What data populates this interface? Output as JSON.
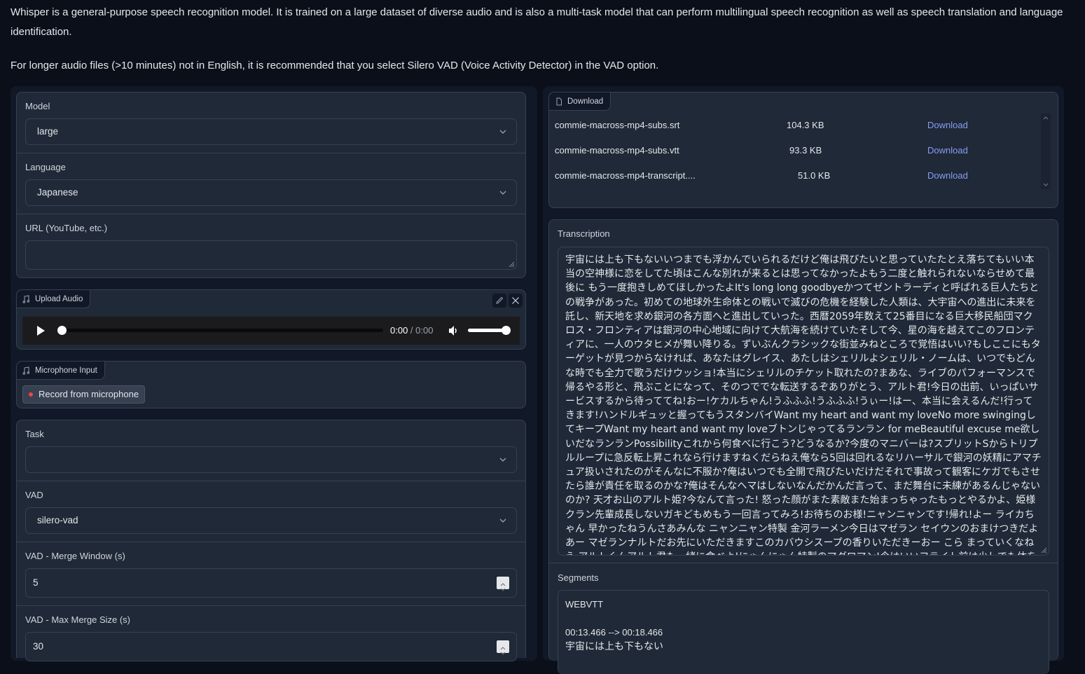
{
  "intro": {
    "paragraph1": "Whisper is a general-purpose speech recognition model. It is trained on a large dataset of diverse audio and is also a multi-task model that can perform multilingual speech recognition as well as speech translation and language identification.",
    "paragraph2": "For longer audio files (>10 minutes) not in English, it is recommended that you select Silero VAD (Voice Activity Detector) in the VAD option."
  },
  "left": {
    "model": {
      "label": "Model",
      "value": "large"
    },
    "language": {
      "label": "Language",
      "value": "Japanese"
    },
    "url": {
      "label": "URL (YouTube, etc.)",
      "value": ""
    },
    "upload_audio": {
      "label": "Upload Audio",
      "current_time": "0:00",
      "separator": " / ",
      "duration": "0:00",
      "progress_fraction": 0,
      "volume_fraction": 1.0
    },
    "microphone": {
      "label": "Microphone Input",
      "record_button": "Record from microphone"
    },
    "task": {
      "label": "Task",
      "value": ""
    },
    "vad": {
      "label": "VAD",
      "value": "silero-vad"
    },
    "vad_merge_window": {
      "label": "VAD - Merge Window (s)",
      "value": "5"
    },
    "vad_max_merge_size": {
      "label": "VAD - Max Merge Size (s)",
      "value": "30"
    }
  },
  "right": {
    "download": {
      "label": "Download",
      "files": [
        {
          "name": "commie-macross-mp4-subs.srt",
          "size": "104.3 KB",
          "link": "Download"
        },
        {
          "name": "commie-macross-mp4-subs.vtt",
          "size": "93.3 KB",
          "link": "Download"
        },
        {
          "name": "commie-macross-mp4-transcript....",
          "size": "51.0 KB",
          "link": "Download"
        }
      ]
    },
    "transcription": {
      "label": "Transcription",
      "text": "宇宙には上も下もないいつまでも浮かんでいられるだけど俺は飛びたいと思っていたたとえ落ちてもいい本当の空神様に恋をしてた頃はこんな別れが来るとは思ってなかったよもう二度と触れられないならせめて最後に もう一度抱きしめてほしかったよIt's long long goodbyeかつてゼントラーディと呼ばれる巨人たちとの戦争があった。初めての地球外生命体との戦いで滅びの危機を経験した人類は、大宇宙への進出に未来を託し、新天地を求め銀河の各方面へと進出していった。西暦2059年数えて25番目になる巨大移民船団マクロス・フロンティアは銀河の中心地域に向けて大航海を続けていたそして今、星の海を越えてこのフロンティアに、一人のウタヒメが舞い降りる。ずいぶんクラシックな街並みねところで覚悟はいい?もしここにもターゲットが見つからなければ、あなたはグレイス、あたしはシェリルよシェリル・ノームは、いつでもどんな時でも全力で歌うだけウッショ!本当にシェリルのチケット取れたの?まあな、ライブのパフォーマンスで帰るやる形と、飛ぶことになって、そのつででな転送するぞありがとう、アルト君!今日の出前、いっぱいサービスするから待っててね!おー!ケカルちゃん!うふふふ!うふふふ!うぃー!はー、本当に会えるんだ!行ってきます!ハンドルギュッと握ってもうスタンバイWant my heart and want my loveNo more swingingしてキープWant my heart and want my loveブトンじゃってるランラン for meBeautiful excuse me欲しいだなランランPossibilityこれから何食べに行こう?どうなるか?今度のマニバーは?スプリットSからトリプルループに急反転上昇これなら行けますねくだらねえ俺なら5回は回れるなリハーサルで銀河の妖精にアマチュア扱いされたのがそんなに不服か?俺はいつでも全開で飛びたいだけだそれで事故って観客にケガでもさせたら誰が責任を取るのかな?俺はそんなヘマはしないなんだかんだ言って、まだ舞台に未練があるんじゃないのか? 天才お山のアルト姫?今なんて言った! 怒った顔がまた素敵また始まっちゃったもっとやるかよ、姫様クラン先輩成長しないガキどもめもう一回言ってみろ!お待ちのお様!ニャンニャンです!帰れ!よー ライカちゃん 早かったねうんさあみんな ニャンニャン特製 金河ラーメン今日はマゼラン セイウンのおまけつきだよあー マゼランナルトだお先にいただきますこのカバウシスープの香りいただきーおー こら まっていくなねえ アルトくんアルト君も一緒に食べよ!にゃんにゃん特製のマグロマン!今はいいフライト前は少しでも体を軽くこれは支たせたみん"
    },
    "segments": {
      "label": "Segments",
      "header": "WEBVTT",
      "first_cue_time": "00:13.466 --> 00:18.466",
      "first_cue_text": "宇宙には上も下もない"
    }
  },
  "colors": {
    "page_bg": "#0b0f19",
    "panel_bg": "#1f2937",
    "border": "#374151",
    "link": "#8b9cf4",
    "record_dot": "#ef4444"
  }
}
